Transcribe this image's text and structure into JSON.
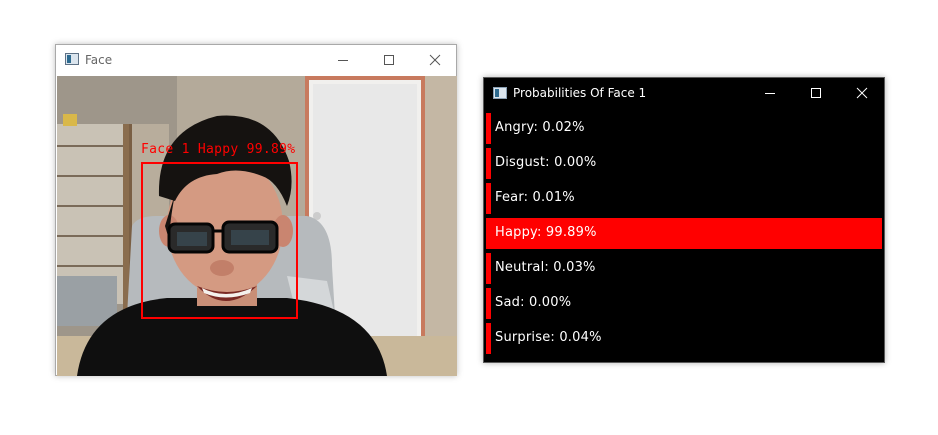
{
  "face_window": {
    "title": "Face",
    "detection_label": "Face 1 Happy 99.89%"
  },
  "prob_window": {
    "title": "Probabilities Of Face 1",
    "bar_color": "#ff0000",
    "emotions": [
      {
        "label": "Angry: 0.02%",
        "value": 0.02
      },
      {
        "label": "Disgust: 0.00%",
        "value": 0.0
      },
      {
        "label": "Fear: 0.01%",
        "value": 0.01
      },
      {
        "label": "Happy: 99.89%",
        "value": 99.89
      },
      {
        "label": "Neutral: 0.03%",
        "value": 0.03
      },
      {
        "label": "Sad: 0.00%",
        "value": 0.0
      },
      {
        "label": "Surprise: 0.04%",
        "value": 0.04
      }
    ]
  }
}
